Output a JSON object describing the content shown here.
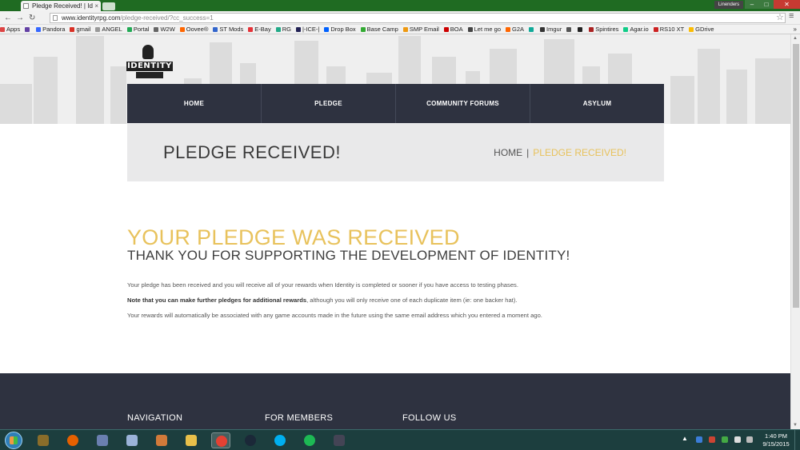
{
  "browser": {
    "tab_title": "Pledge Received! | Id",
    "tab_close": "×",
    "user_label": "Linenders",
    "window_controls": {
      "minimize": "–",
      "maximize": "□",
      "close": "✕"
    },
    "url_host": "www.identityrpg.com",
    "url_path": "/pledge-received/?cc_success=1",
    "bookmarks": [
      {
        "label": "Apps",
        "color": "#d44"
      },
      {
        "label": "",
        "color": "#6441a5"
      },
      {
        "label": "Pandora",
        "color": "#3668ff"
      },
      {
        "label": "gmail",
        "color": "#d93025"
      },
      {
        "label": "ANGEL",
        "color": "#999"
      },
      {
        "label": "Portal",
        "color": "#2a5"
      },
      {
        "label": "W2W",
        "color": "#666"
      },
      {
        "label": "Oovee®",
        "color": "#f60"
      },
      {
        "label": "ST Mods",
        "color": "#36c"
      },
      {
        "label": "E-Bay",
        "color": "#e53238"
      },
      {
        "label": "RG",
        "color": "#2a8"
      },
      {
        "label": "|-ICE-|",
        "color": "#225"
      },
      {
        "label": "Drop Box",
        "color": "#0061fe"
      },
      {
        "label": "Base Camp",
        "color": "#3a3"
      },
      {
        "label": "SMP Email",
        "color": "#e91"
      },
      {
        "label": "BOA",
        "color": "#c00"
      },
      {
        "label": "Let me go",
        "color": "#444"
      },
      {
        "label": "G2A",
        "color": "#f60"
      },
      {
        "label": "",
        "color": "#1a9"
      },
      {
        "label": "Imgur",
        "color": "#333"
      },
      {
        "label": "",
        "color": "#555"
      },
      {
        "label": "",
        "color": "#222"
      },
      {
        "label": "Spintires",
        "color": "#a22"
      },
      {
        "label": "Agar.io",
        "color": "#1c8"
      },
      {
        "label": "RS10 XT",
        "color": "#c22"
      },
      {
        "label": "GDrive",
        "color": "#fbbc04"
      }
    ],
    "bookmarks_more": "»"
  },
  "site": {
    "logo_text": "IDENTITY",
    "nav": [
      "HOME",
      "PLEDGE",
      "COMMUNITY FORUMS",
      "ASYLUM"
    ],
    "page_title": "PLEDGE RECEIVED!",
    "breadcrumb": {
      "home": "HOME",
      "separator": "|",
      "current": "PLEDGE RECEIVED!"
    },
    "headline": "YOUR PLEDGE WAS RECEIVED",
    "subhead": "THANK YOU FOR SUPPORTING THE DEVELOPMENT OF IDENTITY!",
    "paragraphs": {
      "p1": "Your pledge has been received and you will receive all of your rewards when Identity is completed or sooner if you have access to testing phases.",
      "p2_strong": "Note that you can make further pledges for additional rewards",
      "p2_rest": ", although you will only receive one of each duplicate item (ie: one backer hat).",
      "p3": "Your rewards will automatically be associated with any game accounts made in the future using the same email address which you entered a moment ago."
    },
    "footer": {
      "col1": "NAVIGATION",
      "col2": "FOR MEMBERS",
      "col3": "FOLLOW US"
    }
  },
  "taskbar": {
    "apps": [
      "league-of-legends",
      "firefox",
      "paint",
      "notepad",
      "paint-palette",
      "explorer",
      "chrome",
      "steam",
      "skype",
      "spotify",
      "world-of-warships"
    ],
    "tray_arrow": "▲",
    "clock_time": "1:40 PM",
    "clock_date": "9/15/2015"
  },
  "colors": {
    "accent": "#e8c25c",
    "nav_bg": "#2e3240",
    "title_bg": "#e9e9ea"
  }
}
